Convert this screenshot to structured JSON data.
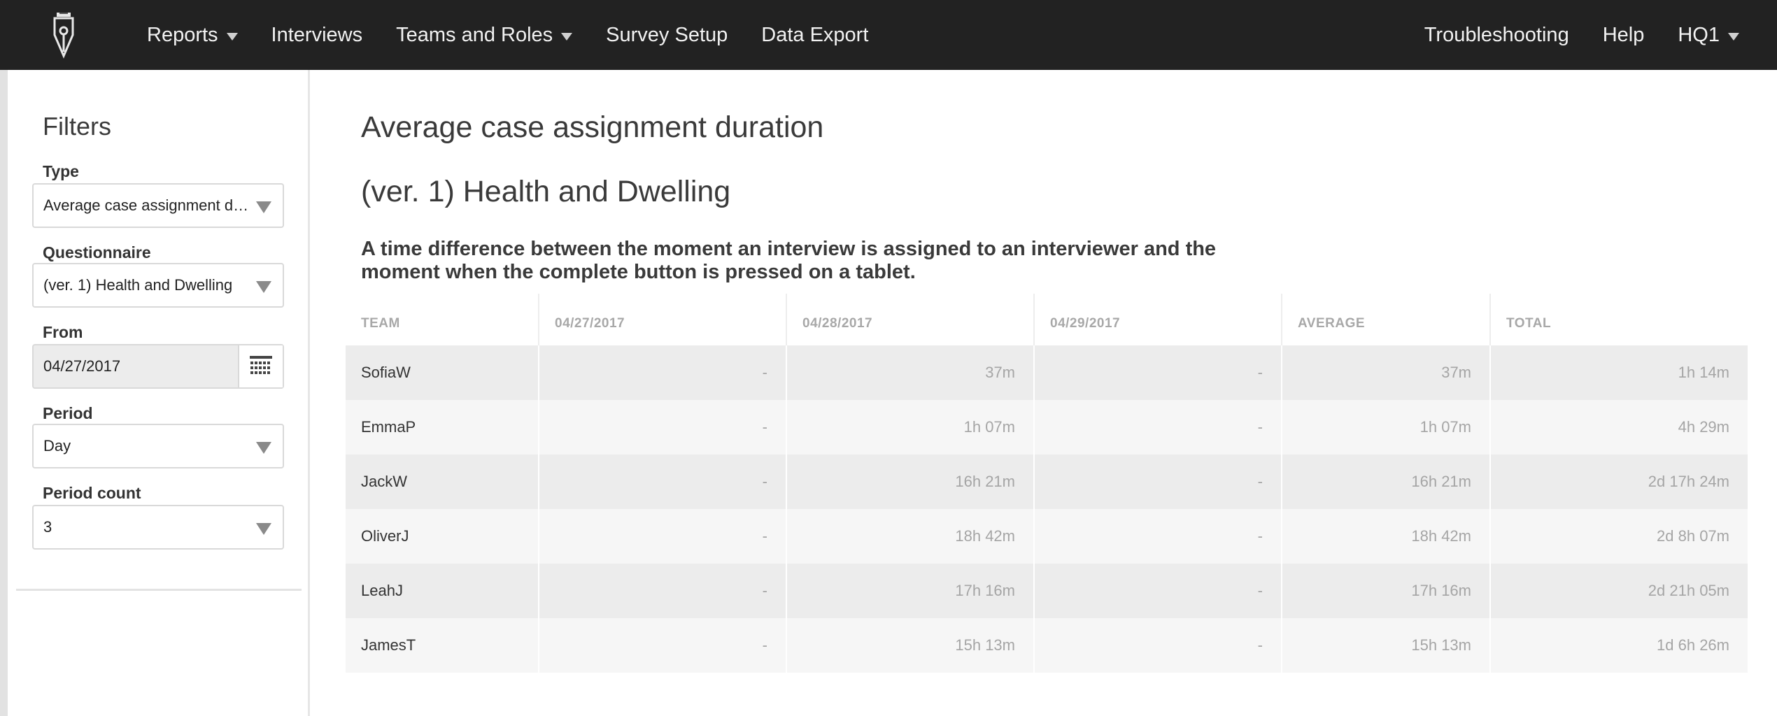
{
  "nav": {
    "left": [
      {
        "label": "Reports",
        "dropdown": true
      },
      {
        "label": "Interviews",
        "dropdown": false
      },
      {
        "label": "Teams and Roles",
        "dropdown": true
      },
      {
        "label": "Survey Setup",
        "dropdown": false
      },
      {
        "label": "Data Export",
        "dropdown": false
      }
    ],
    "right": [
      {
        "label": "Troubleshooting",
        "dropdown": false
      },
      {
        "label": "Help",
        "dropdown": false
      },
      {
        "label": "HQ1",
        "dropdown": true
      }
    ]
  },
  "filters": {
    "title": "Filters",
    "type": {
      "label": "Type",
      "value": "Average case assignment duration"
    },
    "questionnaire": {
      "label": "Questionnaire",
      "value": "(ver. 1) Health and Dwelling"
    },
    "from": {
      "label": "From",
      "value": "04/27/2017",
      "icon": "calendar-icon"
    },
    "period": {
      "label": "Period",
      "value": "Day"
    },
    "period_count": {
      "label": "Period count",
      "value": "3"
    }
  },
  "report": {
    "title": "Average case assignment duration",
    "subtitle": "(ver. 1) Health and Dwelling",
    "description": "A time difference between the moment an interview is assigned to an interviewer and the moment when the complete button is pressed on a tablet.",
    "columns": [
      "TEAM",
      "04/27/2017",
      "04/28/2017",
      "04/29/2017",
      "AVERAGE",
      "TOTAL"
    ],
    "rows": [
      [
        "SofiaW",
        "-",
        "37m",
        "-",
        "37m",
        "1h 14m"
      ],
      [
        "EmmaP",
        "-",
        "1h 07m",
        "-",
        "1h 07m",
        "4h 29m"
      ],
      [
        "JackW",
        "-",
        "16h 21m",
        "-",
        "16h 21m",
        "2d 17h 24m"
      ],
      [
        "OliverJ",
        "-",
        "18h 42m",
        "-",
        "18h 42m",
        "2d 8h 07m"
      ],
      [
        "LeahJ",
        "-",
        "17h 16m",
        "-",
        "17h 16m",
        "2d 21h 05m"
      ],
      [
        "JamesT",
        "-",
        "15h 13m",
        "-",
        "15h 13m",
        "1d 6h 26m"
      ]
    ]
  },
  "colors": {
    "topbar": "#222222",
    "row_odd": "#ececec",
    "row_even": "#f6f6f6"
  }
}
